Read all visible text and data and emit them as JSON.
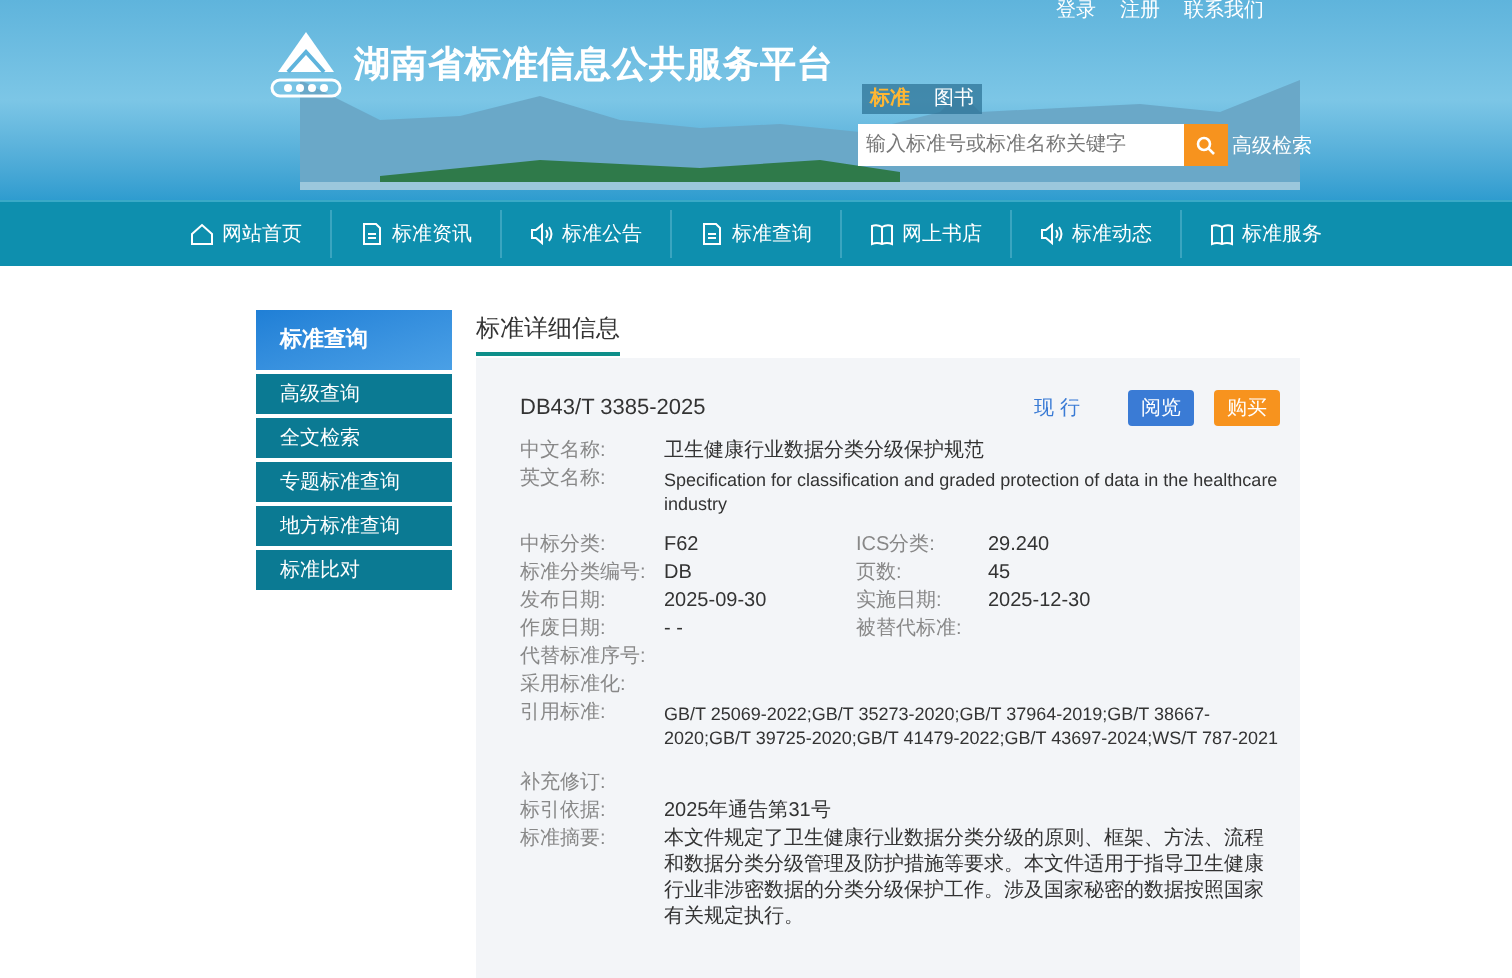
{
  "header": {
    "site_title": "湖南省标准信息公共服务平台",
    "top_links": [
      "登录",
      "注册",
      "联系我们"
    ],
    "search_tabs": [
      {
        "label": "标准",
        "selected": true
      },
      {
        "label": "图书",
        "selected": false
      }
    ],
    "search": {
      "placeholder": "输入标准号或标准名称关键字"
    },
    "advanced_link": "高级检索"
  },
  "nav": [
    {
      "label": "网站首页",
      "kind": "home"
    },
    {
      "label": "标准资讯",
      "kind": "document"
    },
    {
      "label": "标准公告",
      "kind": "speaker"
    },
    {
      "label": "标准查询",
      "kind": "document"
    },
    {
      "label": "网上书店",
      "kind": "book"
    },
    {
      "label": "标准动态",
      "kind": "speaker"
    },
    {
      "label": "标准服务",
      "kind": "book"
    }
  ],
  "sidebar": {
    "title": "标准查询",
    "items": [
      "高级查询",
      "全文检索",
      "专题标准查询",
      "地方标准查询",
      "标准比对"
    ]
  },
  "main": {
    "title": "标准详细信息",
    "code": "DB43/T 3385-2025",
    "status": "现 行",
    "buttons": [
      {
        "label": "阅览",
        "kind": "primary"
      },
      {
        "label": "购买",
        "kind": "buy"
      }
    ],
    "names": [
      {
        "label": "中文名称:",
        "value": "卫生健康行业数据分类分级保护规范"
      },
      {
        "label": "英文名称:",
        "kind": "latin",
        "value": "Specification for classification and graded protection of data in the healthcare industry"
      }
    ],
    "pairs": [
      {
        "label": "中标分类:",
        "value": "F62",
        "label_2": "ICS分类:",
        "value_2": "29.240"
      },
      {
        "label": "标准分类编号:",
        "value": "DB",
        "label_2": "页数:",
        "value_2": "45"
      },
      {
        "label": "发布日期:",
        "value": "2025-09-30",
        "label_2": "实施日期:",
        "value_2": "2025-12-30"
      },
      {
        "label": "作废日期:",
        "value": "- -",
        "label_2": "被替代标准:"
      }
    ],
    "fields": [
      {
        "label": "代替标准序号:"
      },
      {
        "label": "采用标准化:"
      },
      {
        "label": "引用标准:",
        "kind": "latin",
        "value": "GB/T 25069-2022;GB/T 35273-2020;GB/T 37964-2019;GB/T 38667-2020;GB/T 39725-2020;GB/T 41479-2022;GB/T 43697-2024;WS/T 787-2021"
      }
    ],
    "fields_2": [
      {
        "label": "补充修订:"
      },
      {
        "label": "标引依据:",
        "value": "2025年通告第31号"
      },
      {
        "label": "标准摘要:",
        "value": "本文件规定了卫生健康行业数据分类分级的原则、框架、方法、流程和数据分类分级管理及防护措施等要求。本文件适用于指导卫生健康行业非涉密数据的分类分级保护工作。涉及国家秘密的数据按照国家有关规定执行。"
      }
    ]
  }
}
